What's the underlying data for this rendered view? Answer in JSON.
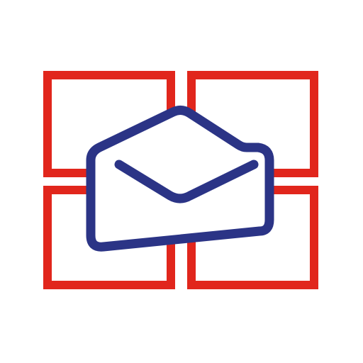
{
  "icon": {
    "name": "mail-app-logo",
    "motif": "open-envelope-over-window-grid",
    "grid_icon": "four-pane-window-icon",
    "envelope_icon": "open-envelope-icon"
  },
  "colors": {
    "background": "#ffffff",
    "grid_red": "#e1261c",
    "envelope_navy": "#2b3486"
  }
}
